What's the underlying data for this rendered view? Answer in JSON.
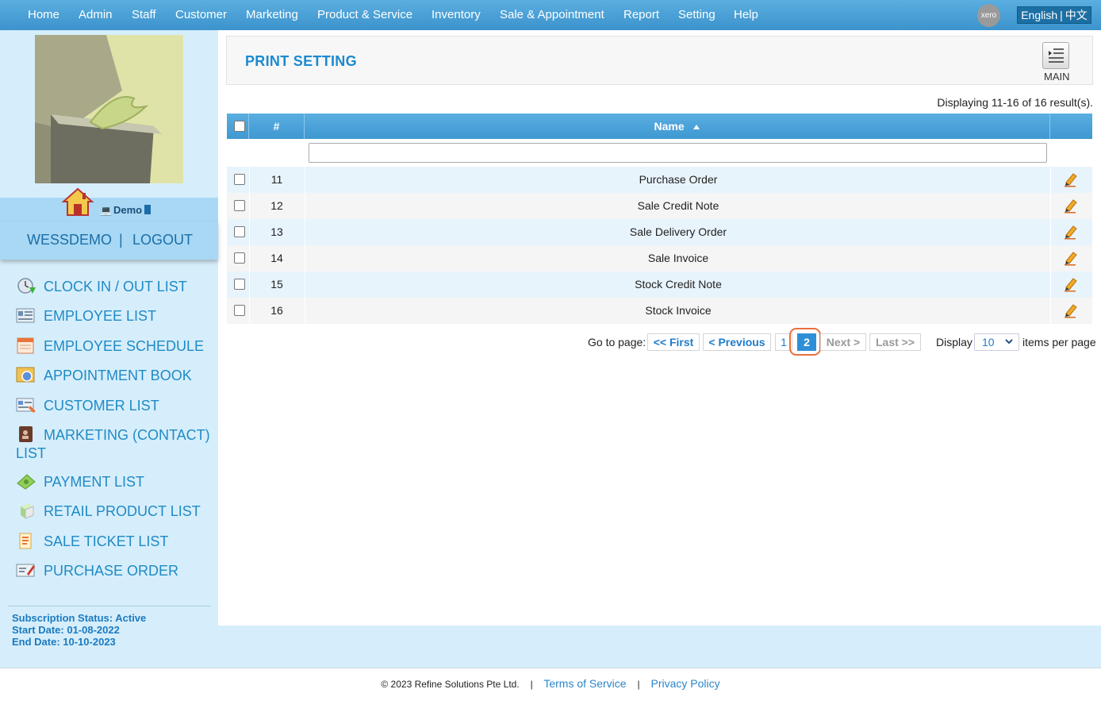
{
  "nav": {
    "items": [
      "Home",
      "Admin",
      "Staff",
      "Customer",
      "Marketing",
      "Product & Service",
      "Inventory",
      "Sale & Appointment",
      "Report",
      "Setting",
      "Help"
    ],
    "xero_label": "xero",
    "lang_english": "English",
    "lang_sep": "|",
    "lang_chinese": "中文"
  },
  "sidebar": {
    "demo_label": "Demo",
    "username": "WESSDEMO",
    "user_sep": "|",
    "logout": "LOGOUT",
    "menu": [
      {
        "label": "CLOCK IN / OUT LIST",
        "icon": "clock-icon"
      },
      {
        "label": "EMPLOYEE LIST",
        "icon": "employee-icon"
      },
      {
        "label": "EMPLOYEE SCHEDULE",
        "icon": "calendar-icon"
      },
      {
        "label": "APPOINTMENT BOOK",
        "icon": "appointment-icon"
      },
      {
        "label": "CUSTOMER LIST",
        "icon": "customer-icon"
      },
      {
        "label": "MARKETING (CONTACT) LIST",
        "icon": "contact-book-icon"
      },
      {
        "label": "PAYMENT LIST",
        "icon": "payment-icon"
      },
      {
        "label": "RETAIL PRODUCT LIST",
        "icon": "product-box-icon"
      },
      {
        "label": "SALE TICKET LIST",
        "icon": "ticket-icon"
      },
      {
        "label": "PURCHASE ORDER",
        "icon": "purchase-order-icon"
      }
    ],
    "subscription_status": "Subscription Status: Active",
    "start_date": "Start Date: 01-08-2022",
    "end_date": "End Date: 10-10-2023"
  },
  "header": {
    "title": "PRINT SETTING",
    "main_label": "MAIN"
  },
  "grid": {
    "result_text": "Displaying 11-16 of 16 result(s).",
    "col_num": "#",
    "col_name": "Name",
    "filter_value": "",
    "rows": [
      {
        "num": "11",
        "name": "Purchase Order"
      },
      {
        "num": "12",
        "name": "Sale Credit Note"
      },
      {
        "num": "13",
        "name": "Sale Delivery Order"
      },
      {
        "num": "14",
        "name": "Sale Invoice"
      },
      {
        "num": "15",
        "name": "Stock Credit Note"
      },
      {
        "num": "16",
        "name": "Stock Invoice"
      }
    ]
  },
  "pager": {
    "goto": "Go to page:",
    "first": "<< First",
    "previous": "< Previous",
    "page1": "1",
    "page2": "2",
    "next": "Next >",
    "last": "Last >>",
    "display": "Display",
    "per_page_value": "10",
    "items_per_page": "items per page"
  },
  "footer": {
    "copyright": "© 2023 Refine Solutions Pte Ltd.",
    "sep": "|",
    "terms": "Terms of Service",
    "privacy": "Privacy Policy"
  },
  "colors": {
    "nav_blue": "#3c93cc",
    "sidebar_bg": "#d6eefb",
    "accent": "#1f8ac6",
    "highlight": "#e8703d"
  }
}
